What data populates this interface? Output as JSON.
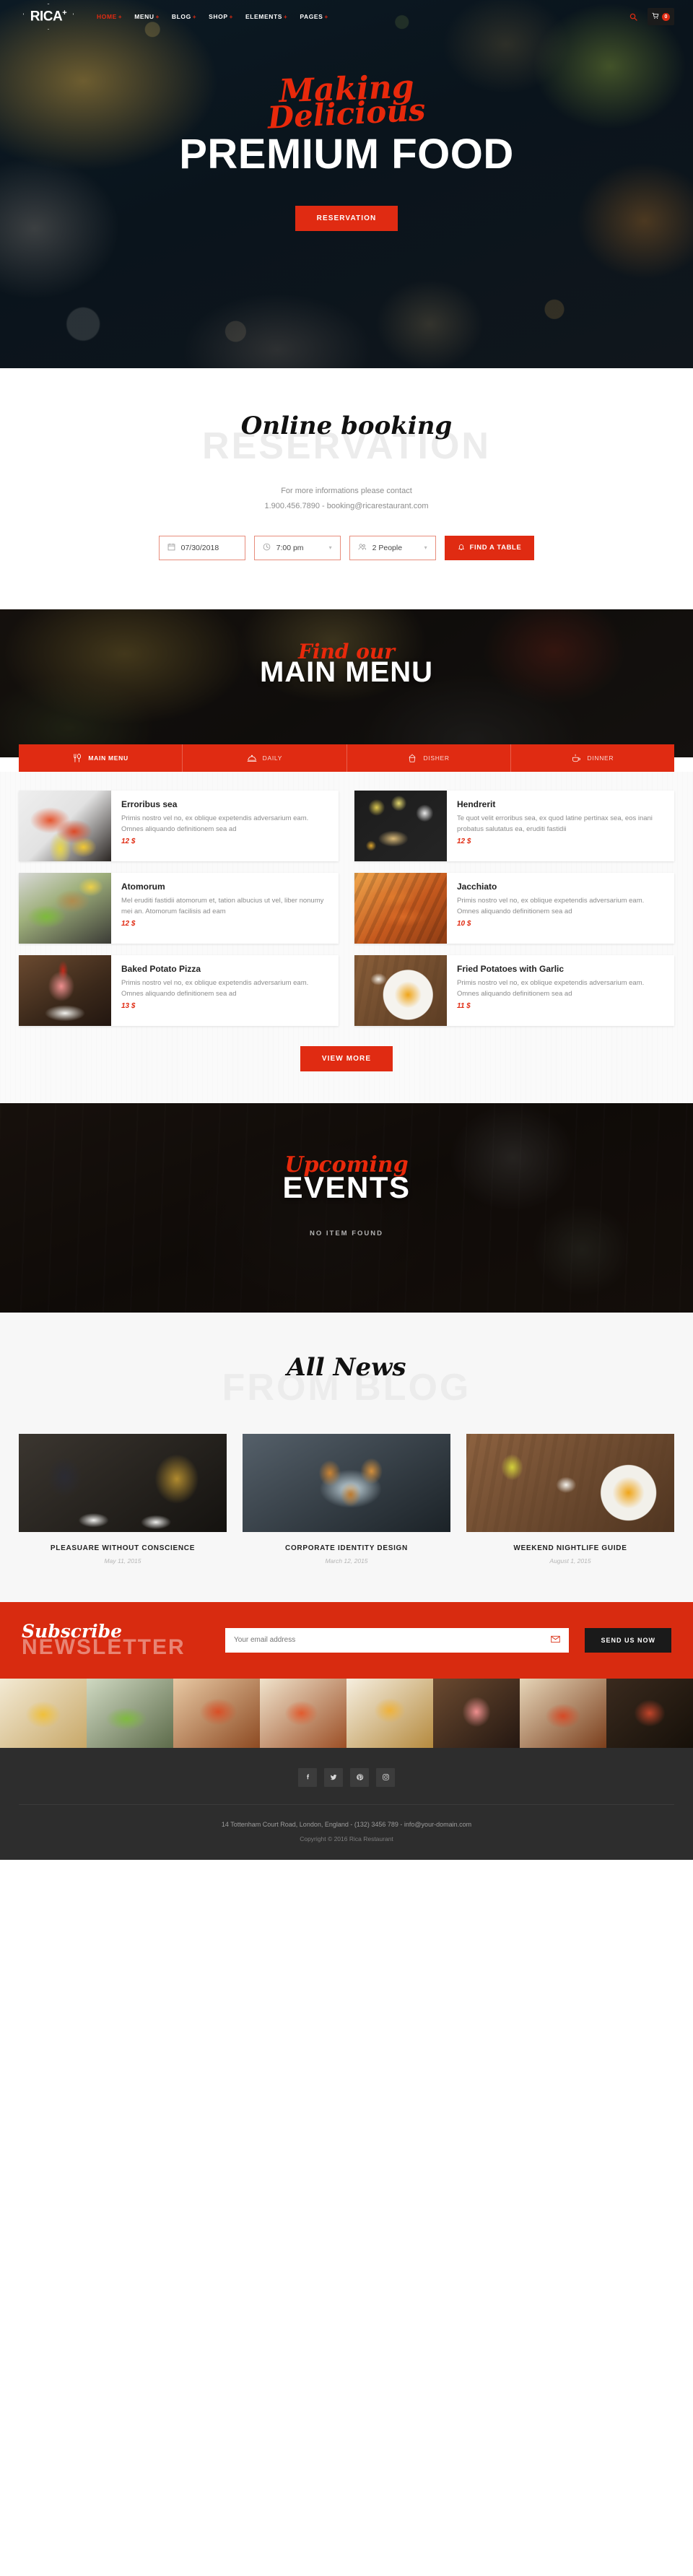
{
  "brand": {
    "name": "RICA",
    "sup": "+"
  },
  "nav": {
    "items": [
      {
        "label": "HOME",
        "active": true,
        "caret": "+"
      },
      {
        "label": "MENU",
        "active": false,
        "caret": "+"
      },
      {
        "label": "BLOG",
        "active": false,
        "caret": "+"
      },
      {
        "label": "SHOP",
        "active": false,
        "caret": "+"
      },
      {
        "label": "ELEMENTS",
        "active": false,
        "caret": "+"
      },
      {
        "label": "PAGES",
        "active": false,
        "caret": "+"
      }
    ],
    "search_icon": "search-icon",
    "cart_icon": "cart-icon",
    "cart_count": "0"
  },
  "hero": {
    "script_line1": "Making",
    "script_line2": "Delicious",
    "title": "PREMIUM FOOD",
    "cta": "RESERVATION"
  },
  "reservation": {
    "script": "Online booking",
    "ghost": "RESERVATION",
    "contact_line1": "For more informations please contact",
    "contact_line2": "1.900.456.7890 - booking@ricarestaurant.com",
    "date_value": "07/30/2018",
    "time_value": "7:00 pm",
    "people_value": "2 People",
    "submit_label": "FIND A TABLE"
  },
  "menu_banner": {
    "script": "Find our",
    "title": "MAIN MENU"
  },
  "menu_tabs": [
    {
      "label": "MAIN MENU",
      "icon": "cutlery-icon",
      "active": true
    },
    {
      "label": "DAILY",
      "icon": "cloche-icon",
      "active": false
    },
    {
      "label": "DISHER",
      "icon": "cupcake-icon",
      "active": false
    },
    {
      "label": "DINNER",
      "icon": "coffee-cup-icon",
      "active": false
    }
  ],
  "menu_items": [
    {
      "name": "Erroribus sea",
      "desc": "Primis nostro vel no, ex oblique expetendis adversarium eam. Omnes aliquando definitionem sea ad",
      "price": "12 $",
      "thumb": "th1"
    },
    {
      "name": "Hendrerit",
      "desc": "Te quot velit erroribus sea, ex quod latine pertinax sea, eos inani probatus salutatus ea, eruditi fastidii",
      "price": "12 $",
      "thumb": "th2"
    },
    {
      "name": "Atomorum",
      "desc": "Mel eruditi fastidii atomorum et, tation albucius ut vel, liber nonumy mei an. Atomorum facilisis ad eam",
      "price": "12 $",
      "thumb": "th3"
    },
    {
      "name": "Jacchiato",
      "desc": "Primis nostro vel no, ex oblique expetendis adversarium eam. Omnes aliquando definitionem sea ad",
      "price": "10 $",
      "thumb": "th4"
    },
    {
      "name": "Baked Potato Pizza",
      "desc": "Primis nostro vel no, ex oblique expetendis adversarium eam. Omnes aliquando definitionem sea ad",
      "price": "13 $",
      "thumb": "th5"
    },
    {
      "name": "Fried Potatoes with Garlic",
      "desc": "Primis nostro vel no, ex oblique expetendis adversarium eam. Omnes aliquando definitionem sea ad",
      "price": "11 $",
      "thumb": "th6"
    }
  ],
  "menu_view_more": "VIEW MORE",
  "events": {
    "script": "Upcoming",
    "title": "EVENTS",
    "empty_message": "NO ITEM FOUND"
  },
  "blog": {
    "script": "All News",
    "ghost": "FROM BLOG",
    "posts": [
      {
        "title": "PLEASUARE WITHOUT CONSCIENCE",
        "date": "May 11, 2015",
        "thumb": "bt1"
      },
      {
        "title": "CORPORATE IDENTITY DESIGN",
        "date": "March 12, 2015",
        "thumb": "bt2"
      },
      {
        "title": "WEEKEND NIGHTLIFE GUIDE",
        "date": "August 1, 2015",
        "thumb": "bt3"
      }
    ]
  },
  "newsletter": {
    "script": "Subscribe",
    "ghost": "NEWSLETTER",
    "placeholder": "Your email address",
    "mail_icon": "envelope-icon",
    "button": "SEND US NOW"
  },
  "instagram_cells": [
    "ic1",
    "ic2",
    "ic3",
    "ic4",
    "ic5",
    "ic6",
    "ic7",
    "ic8"
  ],
  "footer": {
    "socials": [
      {
        "name": "facebook-icon",
        "glyph": "f"
      },
      {
        "name": "twitter-icon",
        "glyph": "t"
      },
      {
        "name": "pinterest-icon",
        "glyph": "p"
      },
      {
        "name": "instagram-icon",
        "glyph": "▣"
      }
    ],
    "address": "14 Tottenham Court Road, London, England - (132) 3456 789 - info@your-domain.com",
    "copyright": "Copyright © 2016 Rica Restaurant"
  },
  "colors": {
    "accent": "#e02b12",
    "dark": "#2d2d2d",
    "ghost": "#ececec"
  }
}
